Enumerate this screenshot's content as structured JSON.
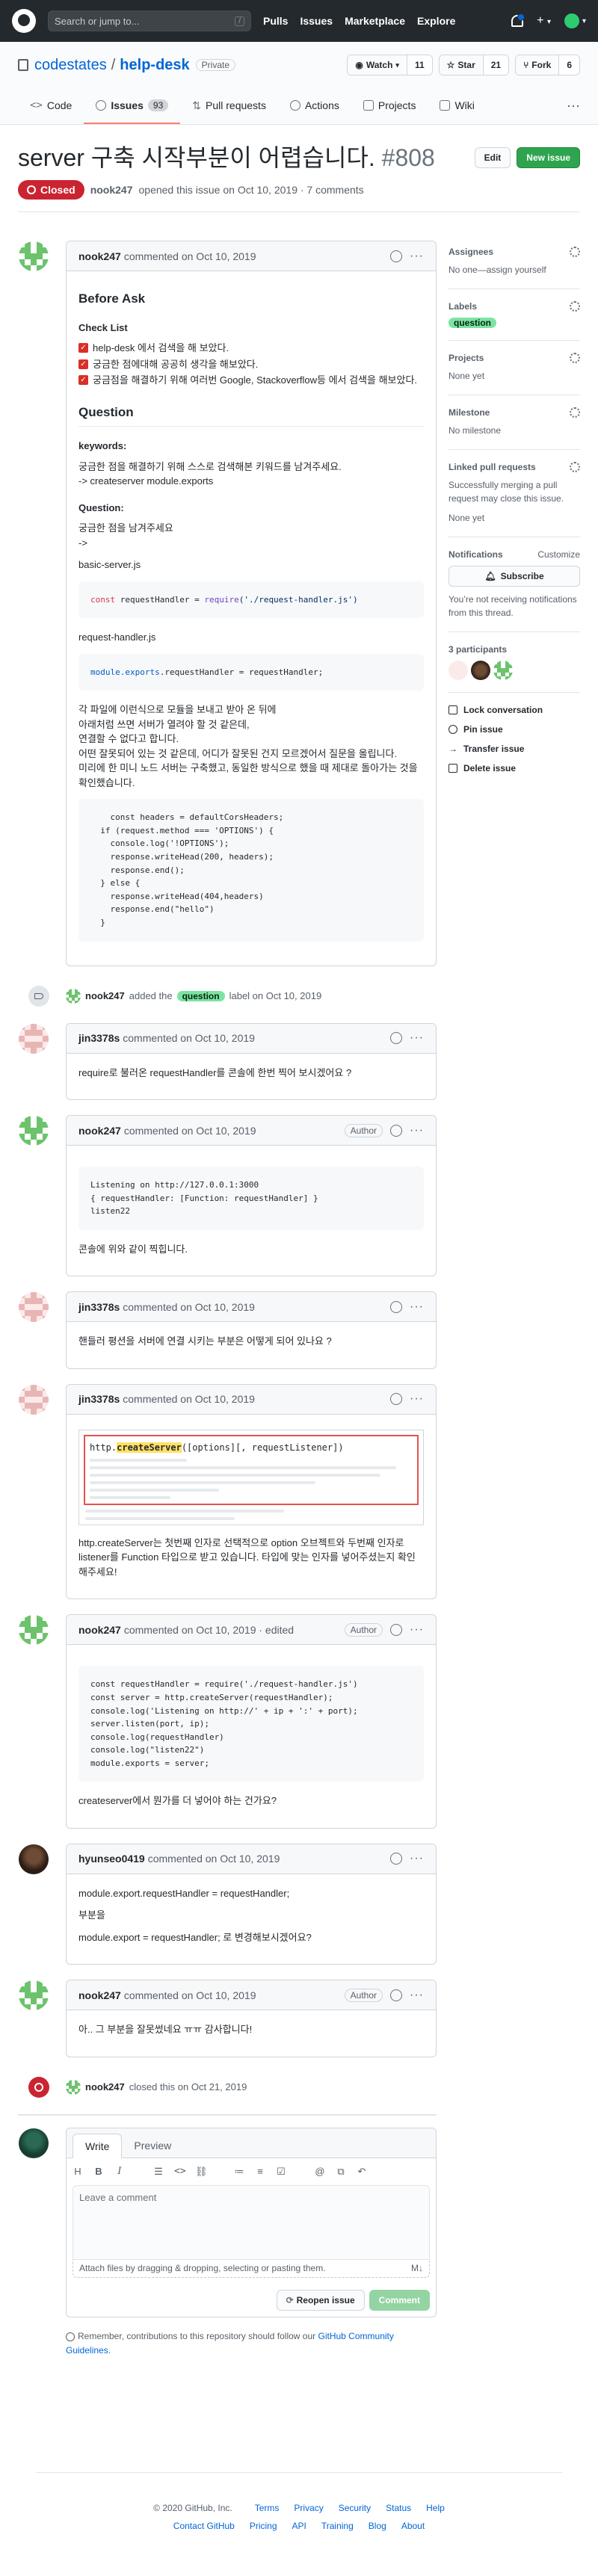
{
  "header": {
    "search_placeholder": "Search or jump to...",
    "search_key": "/",
    "nav": [
      "Pulls",
      "Issues",
      "Marketplace",
      "Explore"
    ],
    "plus": "+",
    "caret": "▾"
  },
  "repo": {
    "owner": "codestates",
    "name": "help-desk",
    "visibility": "Private",
    "watch_label": "Watch",
    "watch_count": "11",
    "star_label": "Star",
    "star_count": "21",
    "fork_label": "Fork",
    "fork_count": "6"
  },
  "tabs": [
    {
      "label": "Code"
    },
    {
      "label": "Issues",
      "count": "93"
    },
    {
      "label": "Pull requests"
    },
    {
      "label": "Actions"
    },
    {
      "label": "Projects"
    },
    {
      "label": "Wiki"
    }
  ],
  "issue": {
    "title": "server 구축 시작부분이 어렵습니다.",
    "number": "#808",
    "edit_label": "Edit",
    "new_issue_label": "New issue",
    "state": "Closed",
    "author": "nook247",
    "meta_text": "opened this issue on Oct 10, 2019 · 7 comments"
  },
  "first_comment": {
    "author": "nook247",
    "time": "commented on Oct 10, 2019",
    "h_before": "Before Ask",
    "h_checklist": "Check List",
    "checklist": [
      "help-desk 에서 검색을 해 보았다.",
      "궁금한 점에대해 공공히 생각을 해보았다.",
      "궁금점을 해결하기 위해 여러번 Google, Stackoverflow등 에서 검색을 해보았다."
    ],
    "h_question": "Question",
    "h_keywords": "keywords:",
    "keywords_text": "궁금한 점을 해결하기 위해 스스로 검색해본 키워드를 남겨주세요.",
    "keywords_value": "-> createserver module.exports",
    "h_question2": "Question:",
    "q_line1": "궁금한 점을 남겨주세요",
    "q_line2": "->",
    "file1": "basic-server.js",
    "code1": {
      "kw": "const",
      "name": " requestHandler = ",
      "fn": "require",
      "str": "('./request-handler.js')"
    },
    "file2": "request-handler.js",
    "code2": {
      "obj": "module",
      "prop": ".exports",
      "rest": ".requestHandler = requestHandler;"
    },
    "para": [
      "각 파일에 이런식으로 모듈을 보내고 받아 온 뒤에",
      "아래처럼 쓰면 서버가 열려야 할 것 같은데,",
      "연결할 수 없다고 합니다.",
      "어떤 잘못되어 있는 것 같은데, 어디가 잘못된 건지 모르겠어서 질문을 올립니다.",
      "미리에 한 미니 노드 서버는 구축했고, 동일한 방식으로 했을 때 제대로 돌아가는 것을 확인했습니다."
    ],
    "code3": [
      "    const headers = defaultCorsHeaders;",
      "  if (request.method === 'OPTIONS') {",
      "    console.log('!OPTIONS');",
      "    response.writeHead(200, headers);",
      "    response.end();",
      "  } else {",
      "    response.writeHead(404,headers)",
      "    response.end(\"hello\")",
      "  }"
    ]
  },
  "label_event": {
    "author": "nook247",
    "text1": "added the",
    "label": "question",
    "text2": "label on Oct 10, 2019"
  },
  "comments": [
    {
      "author": "jin3378s",
      "time": "commented on Oct 10, 2019",
      "body": "require로 불러온 requestHandler를 콘솔에 한번 찍어 보시겠어요 ?"
    },
    {
      "author": "nook247",
      "time": "commented on Oct 10, 2019",
      "badge": "Author",
      "code": [
        "Listening on http://127.0.0.1:3000",
        "{ requestHandler: [Function: requestHandler] }",
        "listen22"
      ],
      "body": "콘솔에 위와 같이 찍힙니다."
    },
    {
      "author": "jin3378s",
      "time": "commented on Oct 10, 2019",
      "body": "핸들러 평션을 서버에 연결 시키는 부분은 어떻게 되어 있나요 ?"
    },
    {
      "author": "jin3378s",
      "time": "commented on Oct 10, 2019",
      "shot_title_pre": "http.",
      "shot_title_hl": "createServer",
      "shot_title_post": "([options][, requestListener])",
      "body": "http.createServer는 첫번째 인자로 선택적으로 option 오브젝트와 두번째 인자로 listener를 Function 타입으로 받고 있습니다. 타입에 맞는 인자를 넣어주셨는지 확인해주세요!"
    },
    {
      "author": "nook247",
      "time": "commented on Oct 10, 2019 · edited",
      "badge": "Author",
      "code": [
        "const requestHandler = require('./request-handler.js')",
        "",
        "const server = http.createServer(requestHandler);",
        "console.log('Listening on http://' + ip + ':' + port);",
        "server.listen(port, ip);",
        "console.log(requestHandler)",
        "console.log(\"listen22\")",
        "",
        "module.exports = server;"
      ],
      "body": "createserver에서 뭔가를 더 넣어야 하는 건가요?"
    },
    {
      "author": "hyunseo0419",
      "time": "commented on Oct 10, 2019",
      "lines": [
        "module.export.requestHandler = requestHandler;",
        "부분을",
        "module.export = requestHandler; 로 변경해보시겠어요?"
      ]
    },
    {
      "author": "nook247",
      "time": "commented on Oct 10, 2019",
      "badge": "Author",
      "body": "아.. 그 부분을 잘못썼네요 ㅠㅠ 감사합니다!"
    }
  ],
  "close_event": {
    "author": "nook247",
    "text": "closed this on Oct 21, 2019"
  },
  "new_comment": {
    "tab_write": "Write",
    "tab_preview": "Preview",
    "placeholder": "Leave a comment",
    "attach": "Attach files by dragging & dropping, selecting or pasting them.",
    "reopen": "Reopen issue",
    "submit": "Comment"
  },
  "tip": {
    "pre": "Remember, contributions to this repository should follow our",
    "link": "GitHub Community Guidelines",
    "post": "."
  },
  "sidebar": {
    "assignees_h": "Assignees",
    "assignees": "No one—assign yourself",
    "labels_h": "Labels",
    "label": "question",
    "projects_h": "Projects",
    "projects": "None yet",
    "milestone_h": "Milestone",
    "milestone": "No milestone",
    "linked_h": "Linked pull requests",
    "linked_desc": "Successfully merging a pull request may close this issue.",
    "linked": "None yet",
    "notif_h": "Notifications",
    "customize": "Customize",
    "subscribe": "Subscribe",
    "notif_desc": "You’re not receiving notifications from this thread.",
    "participants_h": "3 participants",
    "actions": [
      "Lock conversation",
      "Pin issue",
      "Transfer issue",
      "Delete issue"
    ]
  },
  "footer": {
    "copyright": "© 2020 GitHub, Inc.",
    "row1": [
      "Terms",
      "Privacy",
      "Security",
      "Status",
      "Help"
    ],
    "row2": [
      "Contact GitHub",
      "Pricing",
      "API",
      "Training",
      "Blog",
      "About"
    ]
  }
}
